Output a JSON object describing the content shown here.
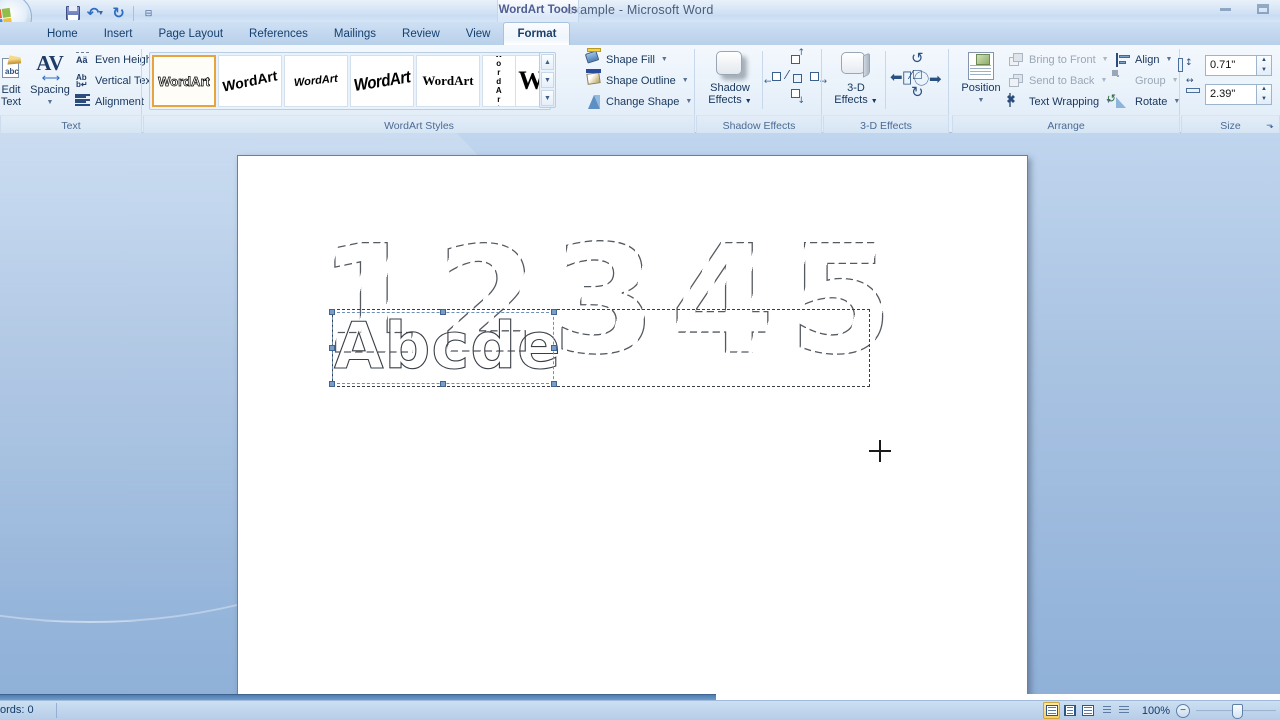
{
  "window": {
    "title": "example - Microsoft Word",
    "contextual_tab_title": "WordArt Tools",
    "minimize_label": "Minimize",
    "restore_label": "Restore"
  },
  "quick_access": {
    "office_button": "Office",
    "items": [
      {
        "name": "save-icon",
        "label": "Save"
      },
      {
        "name": "undo-icon",
        "label": "Undo",
        "glyph": "↶"
      },
      {
        "name": "redo-icon",
        "label": "Redo",
        "glyph": "↻"
      },
      {
        "name": "customize-qat-icon",
        "label": "Customize Quick Access Toolbar",
        "glyph": "–"
      }
    ]
  },
  "tabs": [
    {
      "label": "Home",
      "active": false
    },
    {
      "label": "Insert",
      "active": false
    },
    {
      "label": "Page Layout",
      "active": false
    },
    {
      "label": "References",
      "active": false
    },
    {
      "label": "Mailings",
      "active": false
    },
    {
      "label": "Review",
      "active": false
    },
    {
      "label": "View",
      "active": false
    },
    {
      "label": "Format",
      "active": true
    }
  ],
  "ribbon": {
    "groups": [
      {
        "label": "Text",
        "commands": [
          {
            "label": "Edit\nText",
            "icon": "edit-text-icon",
            "big": true,
            "enabled": true
          },
          {
            "label": "Spacing",
            "icon": "spacing-icon",
            "big": true,
            "enabled": true,
            "dropdown": true
          },
          {
            "label": "Even Height",
            "icon": "even-height-icon",
            "enabled": true
          },
          {
            "label": "Vertical Text",
            "icon": "vertical-text-icon",
            "enabled": true
          },
          {
            "label": "Alignment",
            "icon": "alignment-icon",
            "enabled": true,
            "dropdown": true
          }
        ]
      },
      {
        "label": "WordArt Styles",
        "gallery": [
          {
            "name": "wordart-style-1",
            "text": "WordArt",
            "selected": true
          },
          {
            "name": "wordart-style-2",
            "text": "WordArt",
            "selected": false
          },
          {
            "name": "wordart-style-3",
            "text": "WordArt",
            "selected": false
          },
          {
            "name": "wordart-style-4",
            "text": "WordArt",
            "selected": false
          },
          {
            "name": "wordart-style-5",
            "text": "WordArt",
            "selected": false
          },
          {
            "name": "wordart-style-6",
            "text": "WordArt",
            "selected": false
          },
          {
            "name": "wordart-style-7",
            "text": "W",
            "selected": false
          }
        ],
        "scroll": {
          "up": "▲",
          "down": "▼",
          "more": "▼"
        },
        "commands": [
          {
            "label": "Shape Fill",
            "icon": "shape-fill-icon",
            "enabled": true,
            "dropdown": true
          },
          {
            "label": "Shape Outline",
            "icon": "shape-outline-icon",
            "enabled": true,
            "dropdown": true
          },
          {
            "label": "Change Shape",
            "icon": "change-shape-icon",
            "enabled": true,
            "dropdown": true
          }
        ]
      },
      {
        "label": "Shadow Effects",
        "commands": [
          {
            "label": "Shadow\nEffects",
            "icon": "shadow-effects-icon",
            "big": true,
            "enabled": true,
            "dropdown": true
          },
          {
            "label": "Nudge Shadow Up",
            "icon": "nudge-shadow-up-icon",
            "enabled": true
          },
          {
            "label": "Nudge Shadow Left",
            "icon": "nudge-shadow-left-icon",
            "enabled": true
          },
          {
            "label": "Shadow On/Off",
            "icon": "shadow-toggle-icon",
            "enabled": true
          },
          {
            "label": "Nudge Shadow Right",
            "icon": "nudge-shadow-right-icon",
            "enabled": true
          },
          {
            "label": "Nudge Shadow Down",
            "icon": "nudge-shadow-down-icon",
            "enabled": true
          }
        ]
      },
      {
        "label": "3-D Effects",
        "commands": [
          {
            "label": "3-D\nEffects",
            "icon": "three-d-effects-icon",
            "big": true,
            "enabled": true,
            "dropdown": true
          },
          {
            "label": "Tilt Up",
            "icon": "tilt-up-icon",
            "enabled": true
          },
          {
            "label": "Tilt Left",
            "icon": "tilt-left-icon",
            "enabled": true
          },
          {
            "label": "3-D On/Off",
            "icon": "three-d-toggle-icon",
            "enabled": true
          },
          {
            "label": "Tilt Right",
            "icon": "tilt-right-icon",
            "enabled": true
          },
          {
            "label": "Tilt Down",
            "icon": "tilt-down-icon",
            "enabled": true
          }
        ]
      },
      {
        "label": "Arrange",
        "commands": [
          {
            "label": "Position",
            "icon": "position-icon",
            "big": true,
            "enabled": true,
            "dropdown": true
          },
          {
            "label": "Bring to Front",
            "icon": "bring-to-front-icon",
            "enabled": false,
            "dropdown": true
          },
          {
            "label": "Send to Back",
            "icon": "send-to-back-icon",
            "enabled": false,
            "dropdown": true
          },
          {
            "label": "Text Wrapping",
            "icon": "text-wrapping-icon",
            "enabled": true,
            "dropdown": true
          },
          {
            "label": "Align",
            "icon": "align-icon",
            "enabled": true,
            "dropdown": true
          },
          {
            "label": "Group",
            "icon": "group-icon",
            "enabled": false,
            "dropdown": true
          },
          {
            "label": "Rotate",
            "icon": "rotate-icon",
            "enabled": true,
            "dropdown": true
          }
        ]
      },
      {
        "label": "Size",
        "fields": [
          {
            "name": "shape-height",
            "icon": "shape-height-icon",
            "value": "0.71\""
          },
          {
            "name": "shape-width",
            "icon": "shape-width-icon",
            "value": "2.39\""
          }
        ],
        "dialog_launcher": "⬎"
      }
    ]
  },
  "document": {
    "traced_numbers": [
      "1",
      "2",
      "3",
      "4",
      "5"
    ],
    "selected_wordart": {
      "text": "Abcde",
      "selected": true,
      "handle_count": 8
    },
    "cursor": "crosshair-cursor"
  },
  "status_bar": {
    "word_count": "ords: 0",
    "view_buttons": [
      {
        "name": "print-layout-view",
        "active": true
      },
      {
        "name": "full-screen-reading-view",
        "active": false
      },
      {
        "name": "web-layout-view",
        "active": false
      },
      {
        "name": "outline-view",
        "active": false
      },
      {
        "name": "draft-view",
        "active": false
      }
    ],
    "zoom_level": "100%",
    "zoom_out": "−",
    "zoom_in": "+"
  },
  "colors": {
    "accent_selected": "#e8a33d",
    "ribbon_text": "#17365d",
    "disabled_text": "#9aa7b6",
    "workspace_blue": "#a9c3e2",
    "trace_outline": "#555a60"
  }
}
